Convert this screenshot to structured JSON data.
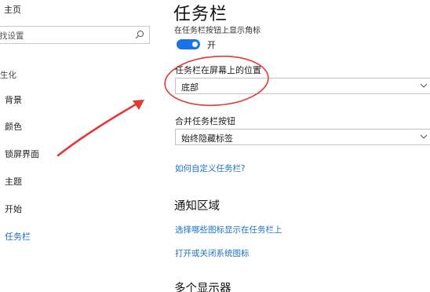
{
  "sidebar": {
    "home_label": "主页",
    "search_placeholder": "找设置",
    "section_label": "生化",
    "items": [
      {
        "label": "背景"
      },
      {
        "label": "颜色"
      },
      {
        "label": "锁屏界面"
      },
      {
        "label": "主题"
      },
      {
        "label": "开始"
      },
      {
        "label": "任务栏"
      }
    ],
    "active_color": "#1a73c7"
  },
  "main": {
    "title": "任务栏",
    "small_buttons_label": "在任务栏按钮上显示角标",
    "toggle_state": "开",
    "location_label": "任务栏在屏幕上的位置",
    "location_value": "底部",
    "combine_label": "合并任务栏按钮",
    "combine_value": "始终隐藏标签",
    "customize_link": "如何自定义任务栏?",
    "notification_section": "通知区域",
    "select_icons_link": "选择哪些图标显示在任务栏上",
    "system_icons_link": "打开或关闭系统图标",
    "multi_display_section": "多个显示器"
  },
  "colors": {
    "accent": "#1a73e8",
    "link": "#1a73c7",
    "annotation_red": "#e53935"
  },
  "icons": {
    "search": "search-icon",
    "chevron": "chevron-down-icon"
  }
}
